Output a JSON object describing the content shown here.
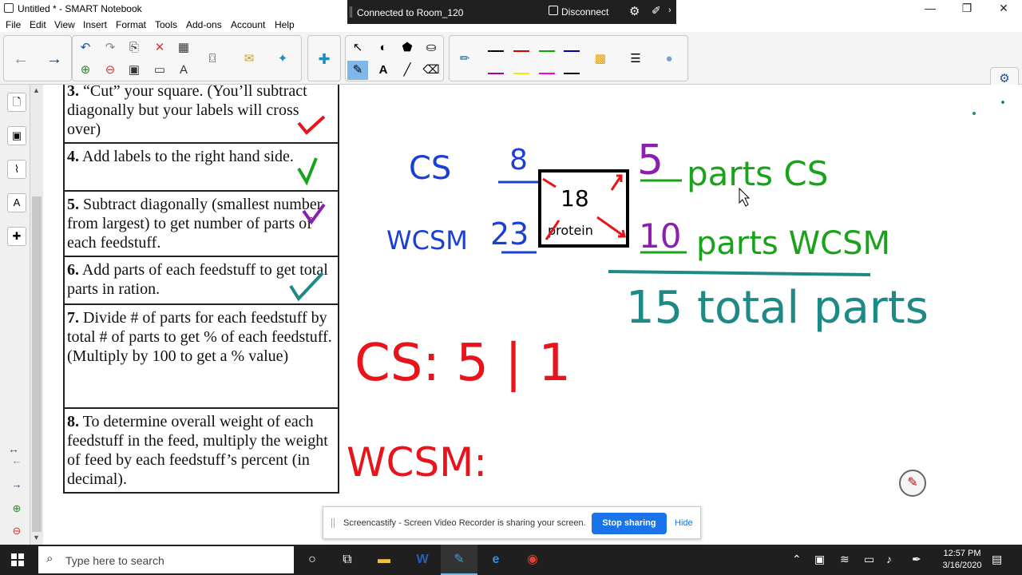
{
  "window": {
    "title": "Untitled * - SMART Notebook",
    "min": "—",
    "restore": "❐",
    "close": "✕"
  },
  "sharebar": {
    "status": "Connected to Room_120",
    "disconnect": "Disconnect"
  },
  "menu": [
    "File",
    "Edit",
    "View",
    "Insert",
    "Format",
    "Tools",
    "Add-ons",
    "Account",
    "Help"
  ],
  "steps": [
    {
      "num": "3.",
      "text": " “Cut” your square. (You’ll subtract diagonally but your labels will cross over)"
    },
    {
      "num": "4.",
      "text": " Add labels to the right hand side."
    },
    {
      "num": "5.",
      "text": " Subtract diagonally (smallest number from largest) to get number of parts of each feedstuff."
    },
    {
      "num": "6.",
      "text": " Add parts of each feedstuff to get total parts in ration."
    },
    {
      "num": "7.",
      "text": " Divide # of parts for each feedstuff by total # of parts to get % of each feedstuff. (Multiply by 100 to get a % value)"
    },
    {
      "num": "8.",
      "text": " To determine overall weight of each feedstuff in the feed, multiply the weight of feed by each feedstuff’s percent (in decimal)."
    }
  ],
  "handwriting": {
    "cs_label": "CS",
    "wcsm_label": "WCSM",
    "cs_value": "8",
    "wcsm_value": "23",
    "square_top": "18",
    "square_bottom": "protein",
    "cs_parts": "5",
    "cs_parts_label": "parts CS",
    "wcsm_parts": "10",
    "wcsm_parts_label": "parts WCSM",
    "total": "15 total parts",
    "cs_calc": "CS: 5 | 1",
    "wcsm_calc": "WCSM:"
  },
  "castify": {
    "message": "Screencastify - Screen Video Recorder is sharing your screen.",
    "stop": "Stop sharing",
    "hide": "Hide"
  },
  "taskbar": {
    "search_placeholder": "Type here to search",
    "time": "12:57 PM",
    "date": "3/16/2020"
  },
  "colors": {
    "blue": "#1a3fd6",
    "purple": "#8a1fb0",
    "green": "#1aa31a",
    "teal": "#1e8a86",
    "red": "#e8141c"
  }
}
